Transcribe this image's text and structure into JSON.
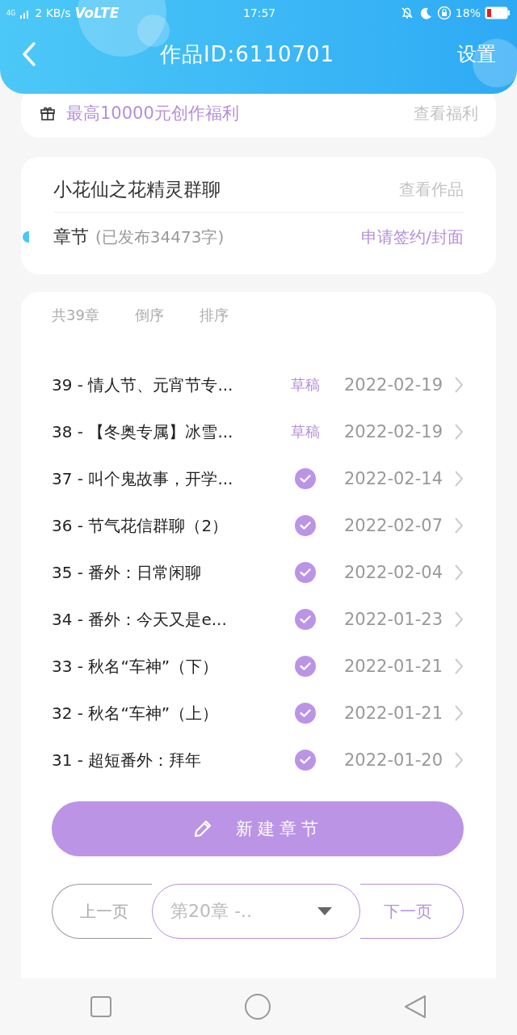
{
  "status_bar": {
    "network": "4G",
    "speed": "2 KB/s",
    "volte": "VoLTE",
    "time": "17:57",
    "battery": "18%"
  },
  "header": {
    "title": "作品ID:6110701",
    "settings": "设置"
  },
  "bonus": {
    "text": "最高10000元创作福利",
    "link": "查看福利"
  },
  "work": {
    "title": "小花仙之花精灵群聊",
    "view": "查看作品",
    "section": "章节",
    "published": "(已发布34473字)",
    "apply": "申请签约/封面"
  },
  "toolbar": {
    "count": "共39章",
    "reverse": "倒序",
    "sort": "排序"
  },
  "chapters": [
    {
      "title": "39 - 情人节、元宵节专...",
      "kind": "draft",
      "badge": "草稿",
      "date": "2022-02-19"
    },
    {
      "title": "38 - 【冬奥专属】冰雪...",
      "kind": "draft",
      "badge": "草稿",
      "date": "2022-02-19"
    },
    {
      "title": "37 - 叫个鬼故事，开学...",
      "kind": "published",
      "date": "2022-02-14"
    },
    {
      "title": "36 - 节气花信群聊（2）",
      "kind": "published",
      "date": "2022-02-07"
    },
    {
      "title": "35 - 番外：日常闲聊",
      "kind": "published",
      "date": "2022-02-04"
    },
    {
      "title": "34 - 番外：今天又是e...",
      "kind": "published",
      "date": "2022-01-23"
    },
    {
      "title": "33 - 秋名“车神”（下）",
      "kind": "published",
      "date": "2022-01-21"
    },
    {
      "title": "32 - 秋名“车神”（上）",
      "kind": "published",
      "date": "2022-01-21"
    },
    {
      "title": "31 - 超短番外：拜年",
      "kind": "published",
      "date": "2022-01-20"
    }
  ],
  "new_button": "新建章节",
  "pager": {
    "prev": {
      "label": "上一页",
      "disabled": true
    },
    "select": "第20章 -..",
    "next": {
      "label": "下一页",
      "disabled": false
    }
  }
}
